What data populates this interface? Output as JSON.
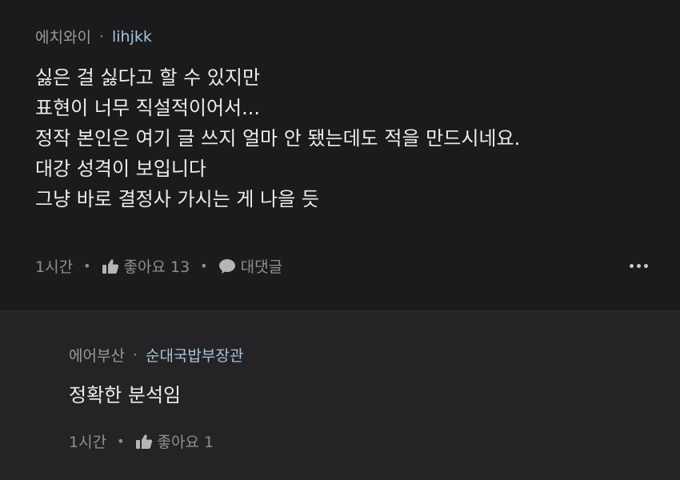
{
  "comments": [
    {
      "author": "에치와이",
      "separator": "·",
      "nickname": "lihjkk",
      "lines": [
        "싫은 걸 싫다고 할 수 있지만",
        "표현이 너무 직설적이어서...",
        "정작 본인은 여기 글 쓰지 얼마 안 됐는데도 적을 만드시네요.",
        "대강 성격이 보입니다",
        "그냥 바로 결정사 가시는 게 나을 듯"
      ],
      "time": "1시간",
      "like_label": "좋아요 13",
      "reply_label": "대댓글"
    },
    {
      "author": "에어부산",
      "separator": "·",
      "nickname": "순대국밥부장관",
      "lines": [
        "정확한 분석임"
      ],
      "time": "1시간",
      "like_label": "좋아요 1"
    }
  ],
  "icons": {
    "like": "thumbs-up-icon",
    "reply": "speech-bubble-icon",
    "more": "more-dots-icon"
  },
  "colors": {
    "background": "#1b1b1d",
    "reply_background": "#242426",
    "nickname": "#a9c2d8",
    "text": "#ececee",
    "muted": "#9a9a9c"
  }
}
